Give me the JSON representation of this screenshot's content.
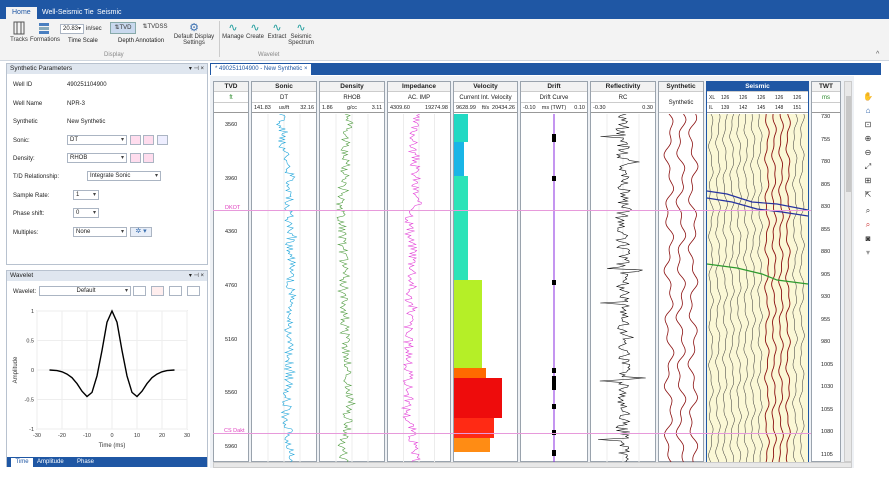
{
  "ribbon": {
    "tabs": [
      "Home",
      "Well-Seismic Tie",
      "Seismic"
    ],
    "tracks": "Tracks",
    "formations": "Formations",
    "scale_value": "20.83",
    "scale_unit": "in/sec",
    "time_scale": "Time Scale",
    "tvd": "TVD",
    "tvdss": "TVDSS",
    "depth_annotation": "Depth Annotation",
    "default_display_settings": "Default Display Settings",
    "display": "Display",
    "manage": "Manage",
    "create": "Create",
    "extract": "Extract",
    "seismic_spectrum": "Seismic Spectrum",
    "wavelet": "Wavelet"
  },
  "synthetic_params": {
    "title": "Synthetic Parameters",
    "well_id_label": "Well ID",
    "well_id": "490251104900",
    "well_name_label": "Well Name",
    "well_name": "NPR-3",
    "synthetic_label": "Synthetic",
    "synthetic": "New Synthetic",
    "sonic_label": "Sonic:",
    "sonic": "DT",
    "density_label": "Density:",
    "density": "RHOB",
    "td_label": "T/D Relationship:",
    "td": "Integrate Sonic",
    "sample_rate_label": "Sample Rate:",
    "sample_rate": "1",
    "phase_shift_label": "Phase shift:",
    "phase_shift": "0",
    "multiples_label": "Multiples:",
    "multiples": "None"
  },
  "wavelet_panel": {
    "title": "Wavelet",
    "wavelet_label": "Wavelet:",
    "wavelet": "Default",
    "bottom_tabs": [
      "Time",
      "Amplitude",
      "Phase"
    ]
  },
  "chart_data": {
    "type": "line",
    "xlabel": "Time (ms)",
    "ylabel": "Amplitude",
    "xlim": [
      -30,
      30
    ],
    "ylim": [
      -1,
      1
    ],
    "xticks": [
      -30,
      -20,
      -10,
      0,
      10,
      20,
      30
    ],
    "yticks": [
      -1,
      -0.5,
      0,
      0.5,
      1
    ],
    "x": [
      -25,
      -22,
      -20,
      -18,
      -16,
      -14,
      -12,
      -10,
      -8,
      -6,
      -4,
      -2,
      0,
      2,
      4,
      6,
      8,
      10,
      12,
      14,
      16,
      18,
      20,
      22,
      25
    ],
    "values": [
      0,
      -0.01,
      -0.03,
      -0.07,
      -0.13,
      -0.23,
      -0.36,
      -0.45,
      -0.38,
      -0.1,
      0.33,
      0.81,
      1,
      0.81,
      0.33,
      -0.1,
      -0.38,
      -0.45,
      -0.36,
      -0.23,
      -0.13,
      -0.07,
      -0.03,
      -0.01,
      0
    ]
  },
  "doc_tab": "* 490251104900 - New Synthetic",
  "tracks": {
    "tvd": {
      "title": "TVD",
      "unit": "ft",
      "labels": [
        "3560",
        "3960",
        "4360",
        "4760",
        "5160",
        "5560",
        "5960"
      ],
      "depth_ticks": [
        3560,
        3960,
        4360,
        4760,
        5160,
        5560,
        5960
      ]
    },
    "sonic": {
      "title": "Sonic",
      "curve": "DT",
      "min": "141.83",
      "unit": "us/ft",
      "max": "32.16"
    },
    "density": {
      "title": "Density",
      "curve": "RHOB",
      "min": "1.86",
      "unit": "g/cc",
      "max": "3.11"
    },
    "impedance": {
      "title": "Impedance",
      "curve": "AC. IMP",
      "min": "4309.60",
      "max": "19274.98"
    },
    "velocity": {
      "title": "Velocity",
      "curve": "Current Int. Velocity",
      "min": "9628.99",
      "unit": "ft/s",
      "max": "20434.26"
    },
    "drift": {
      "title": "Drift",
      "curve": "Drift Curve",
      "min": "-0.10",
      "unit": "ms (TWT)",
      "max": "0.10"
    },
    "reflectivity": {
      "title": "Reflectivity",
      "curve": "RC",
      "min": "-0.30",
      "max": "0.30"
    },
    "synthetic": {
      "title": "Synthetic",
      "curve": "Synthetic"
    },
    "seismic": {
      "title": "Seismic",
      "xl_label": "XL",
      "il_label": "IL",
      "xl": [
        "126",
        "126",
        "126",
        "126",
        "126"
      ],
      "il": [
        "139",
        "142",
        "145",
        "148",
        "151"
      ]
    },
    "twt": {
      "title": "TWT",
      "unit": "ms",
      "labels": [
        "730",
        "755",
        "780",
        "805",
        "830",
        "855",
        "880",
        "905",
        "930",
        "955",
        "980",
        "1005",
        "1030",
        "1055",
        "1080",
        "1105"
      ],
      "time_ticks": [
        730,
        755,
        780,
        805,
        830,
        855,
        880,
        905,
        930,
        955,
        980,
        1005,
        1030,
        1055,
        1080,
        1105
      ]
    }
  },
  "markers": [
    {
      "name": "DKOT",
      "color": "#e040c0"
    },
    {
      "name": "CS Dakt",
      "color": "#e040c0"
    }
  ],
  "colors": {
    "accent": "#1f57a4",
    "sonic": "#1aa3d9",
    "density": "#4c9a3c",
    "impedance": "#e23ad6",
    "synthetic": "#8b1010"
  }
}
